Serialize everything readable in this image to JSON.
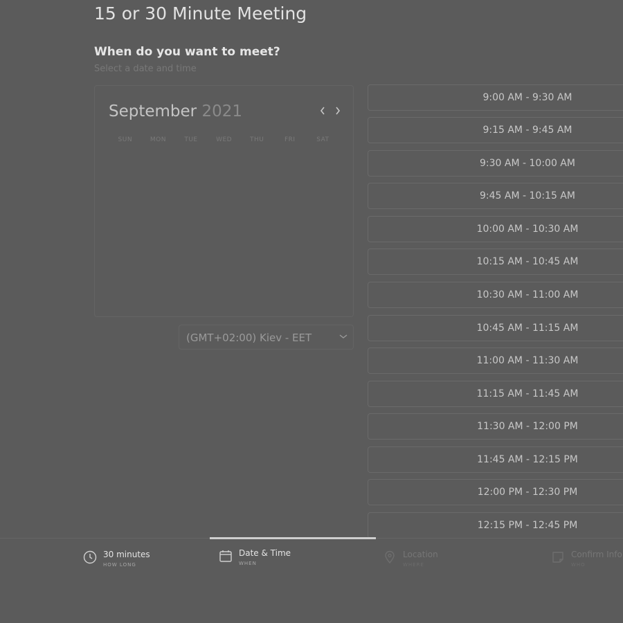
{
  "meeting_title": "15 or 30 Minute Meeting",
  "heading": "When do you want to meet?",
  "subheading": "Select a date and time",
  "calendar": {
    "month": "September",
    "year": "2021",
    "weekdays": [
      "SUN",
      "MON",
      "TUE",
      "WED",
      "THU",
      "FRI",
      "SAT"
    ],
    "prev_icon": "chevron-left-icon",
    "next_icon": "chevron-right-icon"
  },
  "timezone": {
    "selected": "(GMT+02:00) Kiev - EET",
    "icon": "chevron-down-icon"
  },
  "time_slots": [
    "9:00 AM - 9:30 AM",
    "9:15 AM - 9:45 AM",
    "9:30 AM - 10:00 AM",
    "9:45 AM - 10:15 AM",
    "10:00 AM - 10:30 AM",
    "10:15 AM - 10:45 AM",
    "10:30 AM - 11:00 AM",
    "10:45 AM - 11:15 AM",
    "11:00 AM - 11:30 AM",
    "11:15 AM - 11:45 AM",
    "11:30 AM - 12:00 PM",
    "11:45 AM - 12:15 PM",
    "12:00 PM - 12:30 PM",
    "12:15 PM - 12:45 PM"
  ],
  "steps": [
    {
      "title": "30 minutes",
      "sub": "HOW LONG",
      "icon": "clock-icon",
      "state": "active"
    },
    {
      "title": "Date & Time",
      "sub": "WHEN",
      "icon": "calendar-icon",
      "state": "active"
    },
    {
      "title": "Location",
      "sub": "WHERE",
      "icon": "map-pin-icon",
      "state": "inactive"
    },
    {
      "title": "Confirm Info",
      "sub": "WHO",
      "icon": "note-icon",
      "state": "inactive"
    }
  ],
  "colors": {
    "background": "#5b5b5b",
    "text_primary": "#e2e2e2",
    "text_muted": "#787878",
    "border": "#646464",
    "progress": "#cfcfcf"
  }
}
